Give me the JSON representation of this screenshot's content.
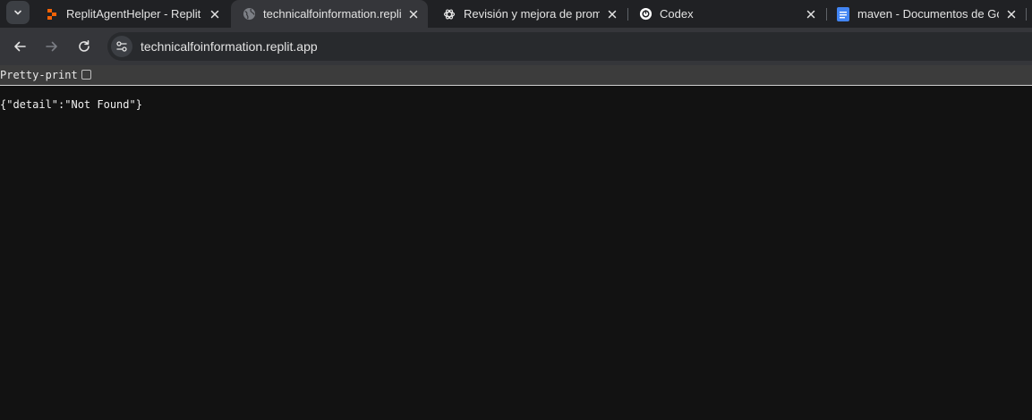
{
  "browser": {
    "tabs": [
      {
        "title": "ReplitAgentHelper - Replit",
        "icon": "replit-icon",
        "active": false
      },
      {
        "title": "technicalfoinformation.replit.app",
        "icon": "globe-icon",
        "active": true
      },
      {
        "title": "Revisión y mejora de prompt",
        "icon": "openai-icon",
        "active": false
      },
      {
        "title": "Codex",
        "icon": "codex-icon",
        "active": false
      },
      {
        "title": "maven - Documentos de Google",
        "icon": "google-docs-icon",
        "active": false
      }
    ],
    "url": "technicalfoinformation.replit.app"
  },
  "viewer": {
    "pretty_print_label": "Pretty-print",
    "pretty_print_checked": false
  },
  "response": {
    "body": "{\"detail\":\"Not Found\"}"
  },
  "colors": {
    "replit_orange": "#f26207",
    "docs_blue": "#4285f4",
    "background": "#121212"
  }
}
